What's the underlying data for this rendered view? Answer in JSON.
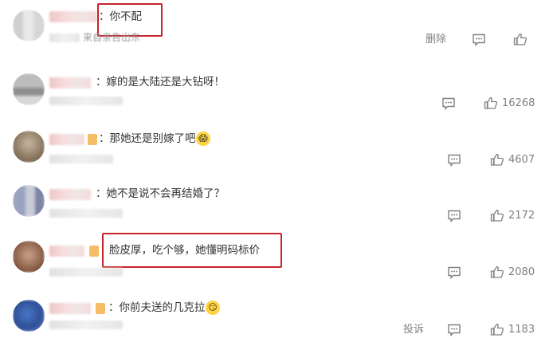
{
  "comments": [
    {
      "text": "：你不配",
      "source": "来自亲告出东",
      "actions": {
        "delete": "删除",
        "likes": ""
      }
    },
    {
      "text": "：嫁的是大陆还是大钻呀！",
      "actions": {
        "likes": "16268"
      }
    },
    {
      "text": "：那她还是别嫁了吧",
      "emoji": "😱",
      "actions": {
        "likes": "4607"
      }
    },
    {
      "text": "：她不是说不会再结婚了？",
      "actions": {
        "likes": "2172"
      }
    },
    {
      "text": "脸皮厚，吃个够，她懂明码标价",
      "actions": {
        "likes": "2080"
      }
    },
    {
      "text": "：你前夫送的几克拉",
      "emoji": "😏",
      "actions": {
        "report": "投诉",
        "likes": "1183"
      }
    }
  ],
  "colors": {
    "highlight_border": "#c8242c",
    "action_gray": "#808080",
    "text": "#333333"
  },
  "icons": {
    "reply": "comment-icon",
    "like": "thumbs-up-icon",
    "badge": "vip-badge-icon"
  }
}
